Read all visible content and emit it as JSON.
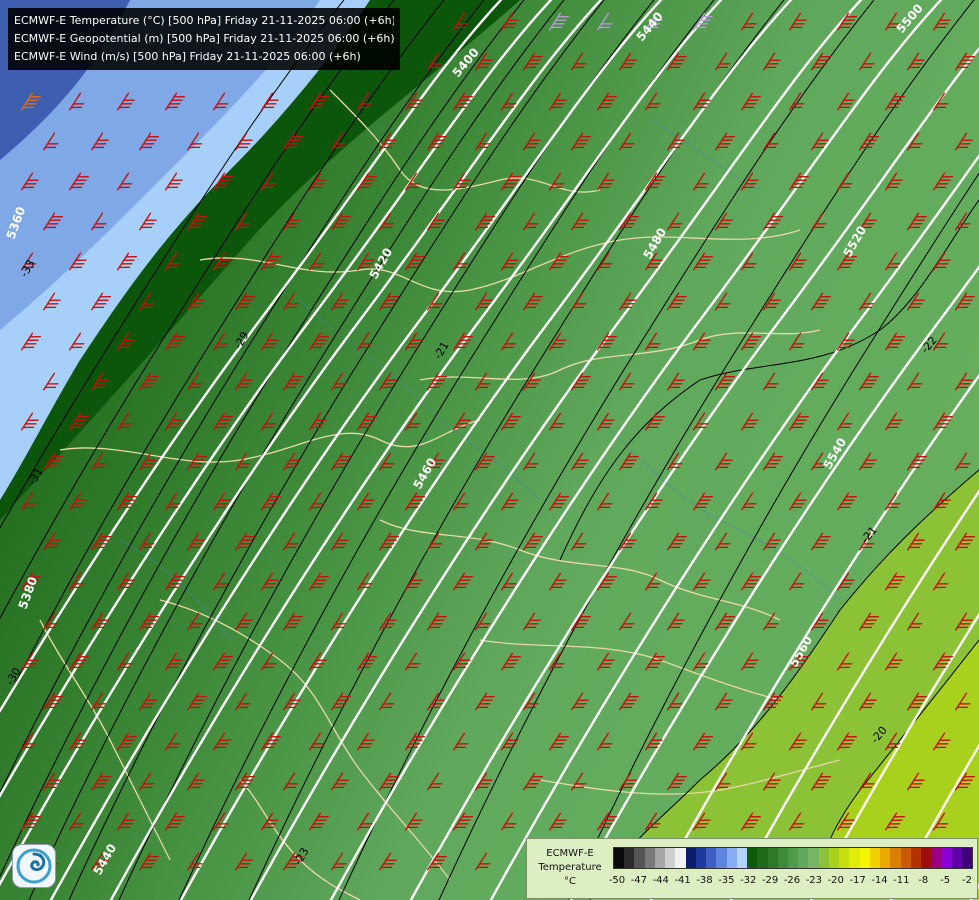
{
  "header": {
    "lines": [
      "ECMWF-E Temperature (°C) [500 hPa] Friday 21-11-2025 06:00 (+6h)",
      "ECMWF-E Geopotential (m) [500 hPa] Friday 21-11-2025 06:00 (+6h)",
      "ECMWF-E Wind (m/s) [500 hPa] Friday 21-11-2025 06:00 (+6h)"
    ]
  },
  "legend": {
    "title_lines": [
      "ECMWF-E",
      "Temperature",
      "°C"
    ],
    "tick_labels": [
      "-50",
      "-47",
      "-44",
      "-41",
      "-38",
      "-35",
      "-32",
      "-29",
      "-26",
      "-23",
      "-20",
      "-17",
      "-14",
      "-11",
      "-8",
      "-5",
      "-2"
    ],
    "colors": [
      "#0a0a0a",
      "#2d2d2d",
      "#555555",
      "#7a7a7a",
      "#a6a6a6",
      "#cfcfcf",
      "#f2f2f2",
      "#0b1d6b",
      "#1f3a9e",
      "#3d5fc4",
      "#5f86de",
      "#86aef0",
      "#b3d4fb",
      "#0b5d0b",
      "#1f6b1b",
      "#2f7a2a",
      "#3f8a3a",
      "#509a4a",
      "#60a85c",
      "#75b765",
      "#8cc236",
      "#a8d11e",
      "#c5df10",
      "#e1ed08",
      "#f7f500",
      "#f2d000",
      "#eaa800",
      "#d98000",
      "#c85a00",
      "#b53100",
      "#9e0c0c",
      "#9c007f",
      "#8c00d6",
      "#5f00a8",
      "#40007a"
    ]
  },
  "map": {
    "geopotential_labels": [
      "5360",
      "5380",
      "5400",
      "5420",
      "5440",
      "5460",
      "5480",
      "5500",
      "5520",
      "5540",
      "5560",
      "5440"
    ],
    "temperature_labels": [
      "-33",
      "-31",
      "-30",
      "-29",
      "-23",
      "-21",
      "-22",
      "-21",
      "-20"
    ]
  },
  "colors": {
    "barb": "#c41010",
    "barb_cold": "#e06a1e",
    "barb_warm": "#b89ad8",
    "isohypse": "#ffffff",
    "isotherm": "#000000",
    "border": "#e8d9a8"
  }
}
